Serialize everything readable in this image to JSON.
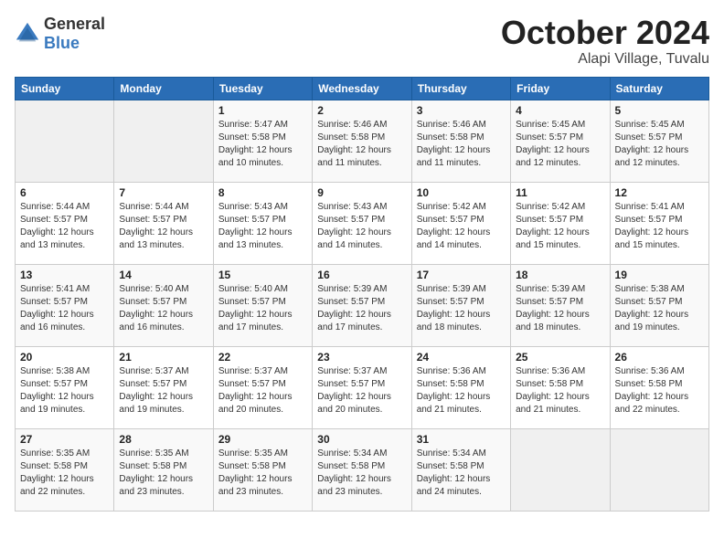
{
  "logo": {
    "general": "General",
    "blue": "Blue"
  },
  "title": "October 2024",
  "location": "Alapi Village, Tuvalu",
  "days_of_week": [
    "Sunday",
    "Monday",
    "Tuesday",
    "Wednesday",
    "Thursday",
    "Friday",
    "Saturday"
  ],
  "weeks": [
    [
      {
        "day": "",
        "info": ""
      },
      {
        "day": "",
        "info": ""
      },
      {
        "day": "1",
        "info": "Sunrise: 5:47 AM\nSunset: 5:58 PM\nDaylight: 12 hours and 10 minutes."
      },
      {
        "day": "2",
        "info": "Sunrise: 5:46 AM\nSunset: 5:58 PM\nDaylight: 12 hours and 11 minutes."
      },
      {
        "day": "3",
        "info": "Sunrise: 5:46 AM\nSunset: 5:58 PM\nDaylight: 12 hours and 11 minutes."
      },
      {
        "day": "4",
        "info": "Sunrise: 5:45 AM\nSunset: 5:57 PM\nDaylight: 12 hours and 12 minutes."
      },
      {
        "day": "5",
        "info": "Sunrise: 5:45 AM\nSunset: 5:57 PM\nDaylight: 12 hours and 12 minutes."
      }
    ],
    [
      {
        "day": "6",
        "info": "Sunrise: 5:44 AM\nSunset: 5:57 PM\nDaylight: 12 hours and 13 minutes."
      },
      {
        "day": "7",
        "info": "Sunrise: 5:44 AM\nSunset: 5:57 PM\nDaylight: 12 hours and 13 minutes."
      },
      {
        "day": "8",
        "info": "Sunrise: 5:43 AM\nSunset: 5:57 PM\nDaylight: 12 hours and 13 minutes."
      },
      {
        "day": "9",
        "info": "Sunrise: 5:43 AM\nSunset: 5:57 PM\nDaylight: 12 hours and 14 minutes."
      },
      {
        "day": "10",
        "info": "Sunrise: 5:42 AM\nSunset: 5:57 PM\nDaylight: 12 hours and 14 minutes."
      },
      {
        "day": "11",
        "info": "Sunrise: 5:42 AM\nSunset: 5:57 PM\nDaylight: 12 hours and 15 minutes."
      },
      {
        "day": "12",
        "info": "Sunrise: 5:41 AM\nSunset: 5:57 PM\nDaylight: 12 hours and 15 minutes."
      }
    ],
    [
      {
        "day": "13",
        "info": "Sunrise: 5:41 AM\nSunset: 5:57 PM\nDaylight: 12 hours and 16 minutes."
      },
      {
        "day": "14",
        "info": "Sunrise: 5:40 AM\nSunset: 5:57 PM\nDaylight: 12 hours and 16 minutes."
      },
      {
        "day": "15",
        "info": "Sunrise: 5:40 AM\nSunset: 5:57 PM\nDaylight: 12 hours and 17 minutes."
      },
      {
        "day": "16",
        "info": "Sunrise: 5:39 AM\nSunset: 5:57 PM\nDaylight: 12 hours and 17 minutes."
      },
      {
        "day": "17",
        "info": "Sunrise: 5:39 AM\nSunset: 5:57 PM\nDaylight: 12 hours and 18 minutes."
      },
      {
        "day": "18",
        "info": "Sunrise: 5:39 AM\nSunset: 5:57 PM\nDaylight: 12 hours and 18 minutes."
      },
      {
        "day": "19",
        "info": "Sunrise: 5:38 AM\nSunset: 5:57 PM\nDaylight: 12 hours and 19 minutes."
      }
    ],
    [
      {
        "day": "20",
        "info": "Sunrise: 5:38 AM\nSunset: 5:57 PM\nDaylight: 12 hours and 19 minutes."
      },
      {
        "day": "21",
        "info": "Sunrise: 5:37 AM\nSunset: 5:57 PM\nDaylight: 12 hours and 19 minutes."
      },
      {
        "day": "22",
        "info": "Sunrise: 5:37 AM\nSunset: 5:57 PM\nDaylight: 12 hours and 20 minutes."
      },
      {
        "day": "23",
        "info": "Sunrise: 5:37 AM\nSunset: 5:57 PM\nDaylight: 12 hours and 20 minutes."
      },
      {
        "day": "24",
        "info": "Sunrise: 5:36 AM\nSunset: 5:58 PM\nDaylight: 12 hours and 21 minutes."
      },
      {
        "day": "25",
        "info": "Sunrise: 5:36 AM\nSunset: 5:58 PM\nDaylight: 12 hours and 21 minutes."
      },
      {
        "day": "26",
        "info": "Sunrise: 5:36 AM\nSunset: 5:58 PM\nDaylight: 12 hours and 22 minutes."
      }
    ],
    [
      {
        "day": "27",
        "info": "Sunrise: 5:35 AM\nSunset: 5:58 PM\nDaylight: 12 hours and 22 minutes."
      },
      {
        "day": "28",
        "info": "Sunrise: 5:35 AM\nSunset: 5:58 PM\nDaylight: 12 hours and 23 minutes."
      },
      {
        "day": "29",
        "info": "Sunrise: 5:35 AM\nSunset: 5:58 PM\nDaylight: 12 hours and 23 minutes."
      },
      {
        "day": "30",
        "info": "Sunrise: 5:34 AM\nSunset: 5:58 PM\nDaylight: 12 hours and 23 minutes."
      },
      {
        "day": "31",
        "info": "Sunrise: 5:34 AM\nSunset: 5:58 PM\nDaylight: 12 hours and 24 minutes."
      },
      {
        "day": "",
        "info": ""
      },
      {
        "day": "",
        "info": ""
      }
    ]
  ]
}
